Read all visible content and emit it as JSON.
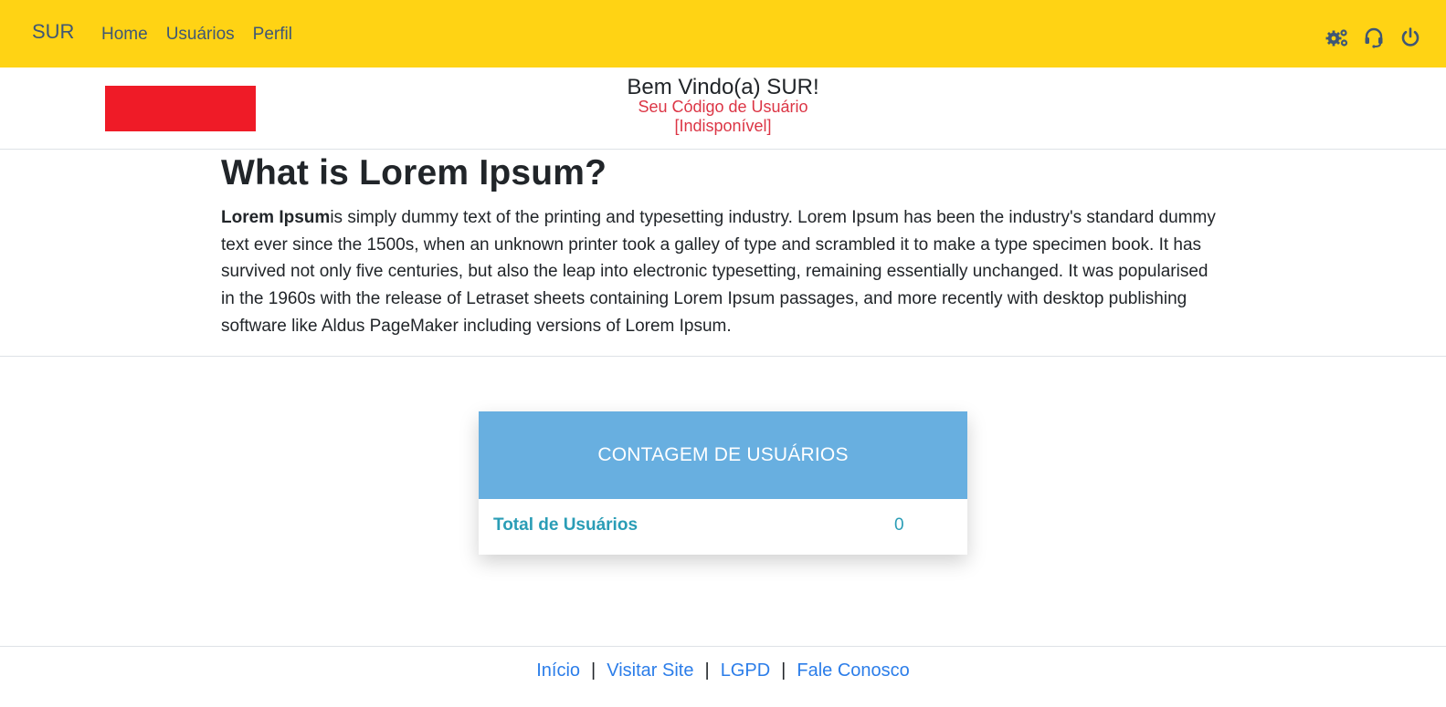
{
  "navbar": {
    "brand": "SUR",
    "links": [
      "Home",
      "Usuários",
      "Perfil"
    ],
    "icons": [
      "settings-gears-icon",
      "headset-support-icon",
      "power-icon"
    ],
    "background_color": "#ffd314",
    "link_color": "#3f5775"
  },
  "welcome": {
    "title": "Bem Vindo(a) SUR!",
    "code_label": "Seu Código de Usuário",
    "code_value": "[Indisponível]",
    "logo_color": "#ef1b27"
  },
  "article": {
    "title": "What is Lorem Ipsum?",
    "bold_lead": "Lorem Ipsum",
    "body": "is simply dummy text of the printing and typesetting industry. Lorem Ipsum has been the industry's standard dummy text ever since the 1500s, when an unknown printer took a galley of type and scrambled it to make a type specimen book. It has survived not only five centuries, but also the leap into electronic typesetting, remaining essentially unchanged. It was popularised in the 1960s with the release of Letraset sheets containing Lorem Ipsum passages, and more recently with desktop publishing software like Aldus PageMaker including versions of Lorem Ipsum."
  },
  "card": {
    "header": "CONTAGEM DE USUÁRIOS",
    "row_label": "Total de Usuários",
    "row_value": "0",
    "header_color": "#68afe0",
    "text_color": "#2a9db6"
  },
  "footer": {
    "links": [
      "Início",
      "Visitar Site",
      "LGPD",
      "Fale Conosco"
    ],
    "separator": "|",
    "link_color": "#2b7de9"
  }
}
